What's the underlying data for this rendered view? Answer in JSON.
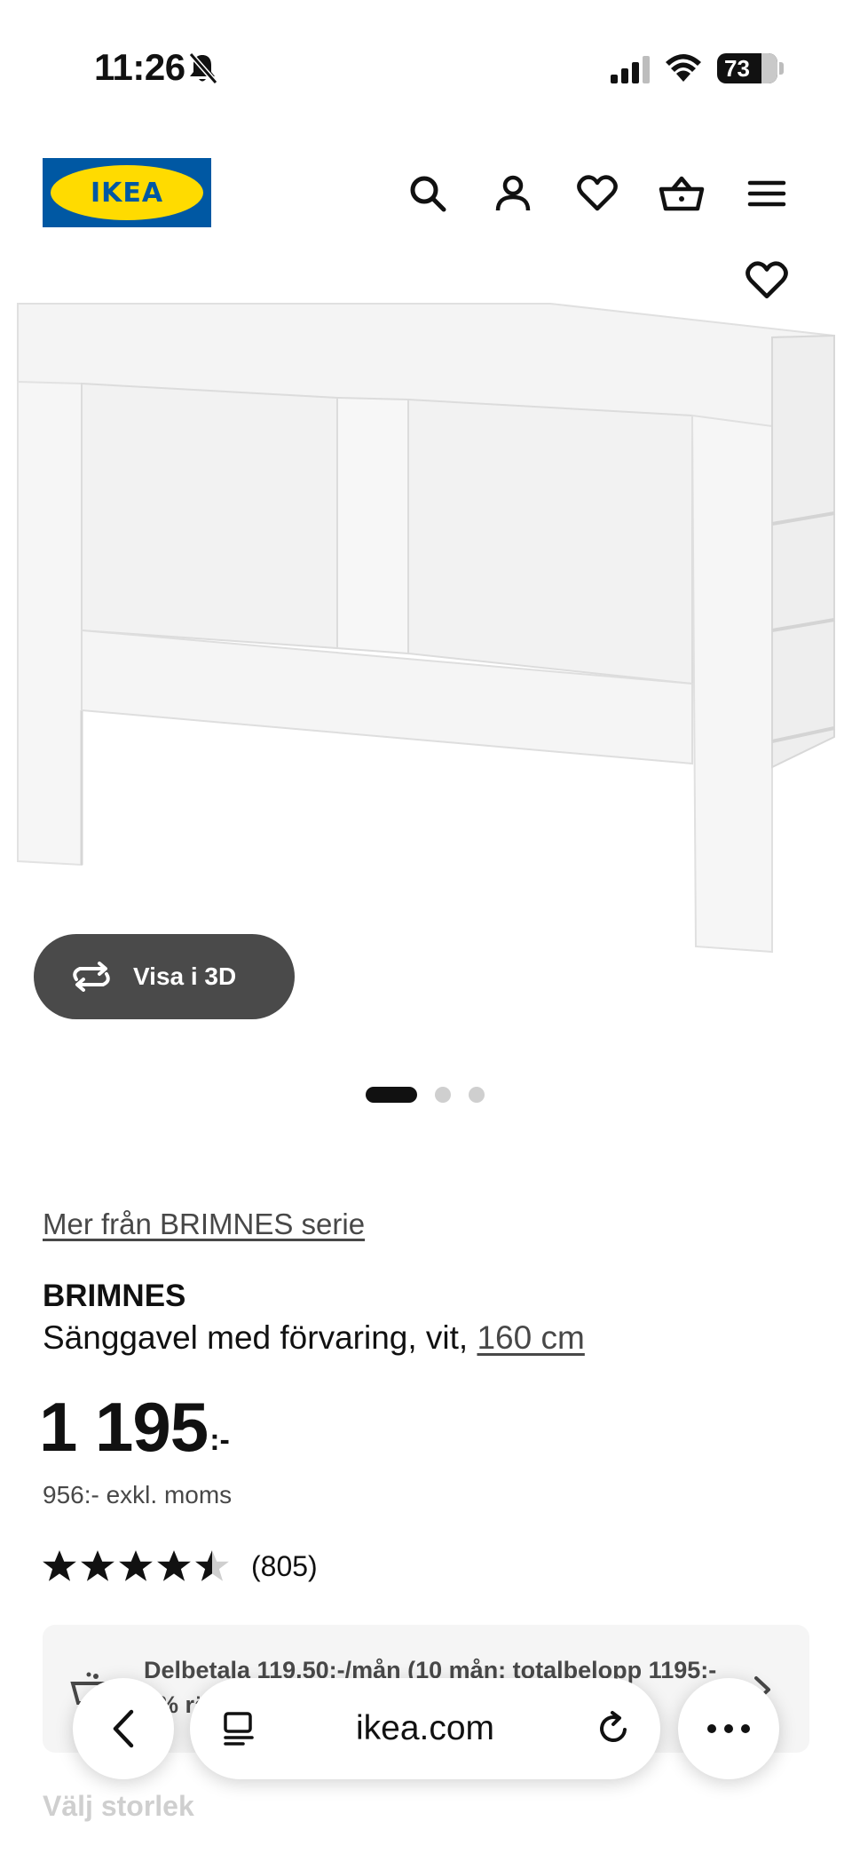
{
  "status_bar": {
    "time": "11:26",
    "battery": "73"
  },
  "header": {
    "logo_text": "IKEA",
    "icons": [
      "search-icon",
      "account-icon",
      "favorites-icon",
      "cart-icon",
      "menu-icon"
    ]
  },
  "gallery": {
    "view_3d_label": "Visa i 3D",
    "slide_count": 3,
    "active_slide": 1
  },
  "product": {
    "series_link": "Mer från BRIMNES serie",
    "name": "BRIMNES",
    "description": "Sänggavel med förvaring, vit, ",
    "size": "160 cm",
    "price": "1 195",
    "price_suffix": ":-",
    "price_ex_vat": "956:- exkl. moms",
    "rating_value": 4.5,
    "rating_count": "(805)"
  },
  "financing": {
    "text": "Delbetala 119.50:-/mån (10 mån: totalbelopp 1195:- 0% ränta) med Ikano Bank"
  },
  "next_section": {
    "label": "Välj storlek"
  },
  "browser": {
    "url": "ikea.com"
  },
  "colors": {
    "ikea_blue": "#0058a3",
    "ikea_yellow": "#ffdb00",
    "button_dark": "#4a4a4a"
  }
}
